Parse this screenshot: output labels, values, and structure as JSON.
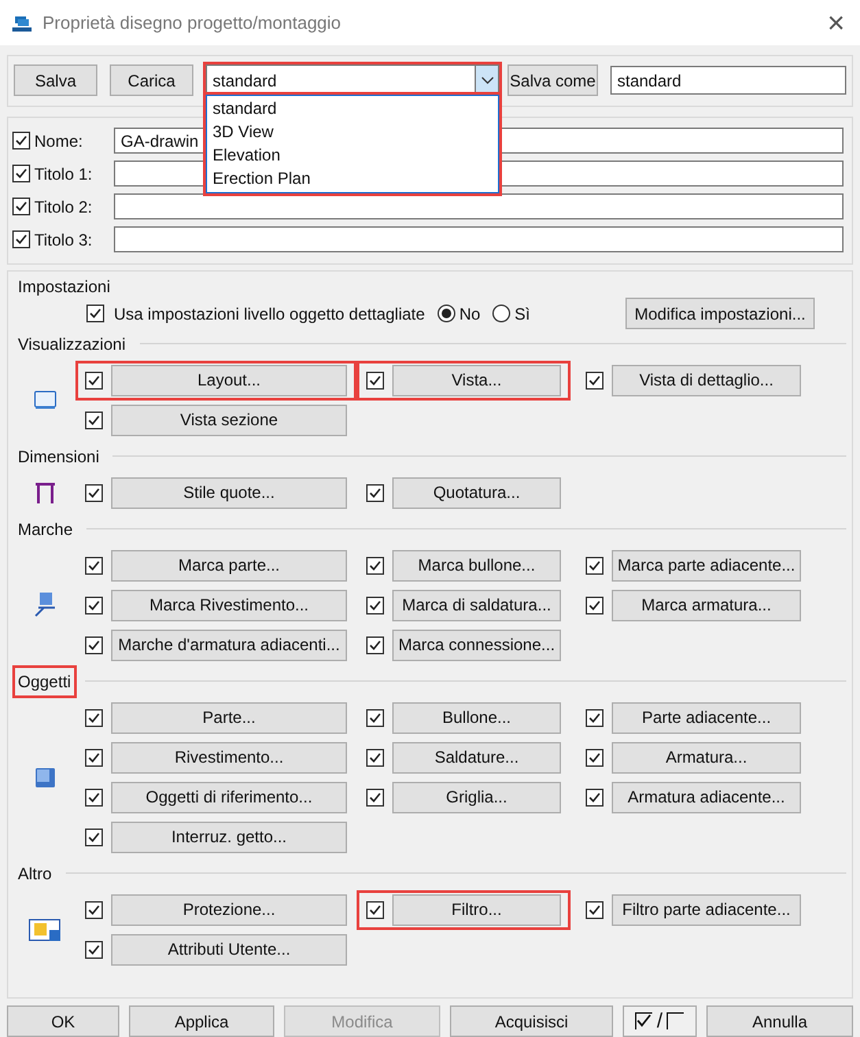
{
  "window": {
    "title": "Proprietà disegno progetto/montaggio",
    "close": "×"
  },
  "toolbar": {
    "buttons": [
      "Salva",
      "Carica"
    ],
    "preset_combo": {
      "value": "standard",
      "expanded": true,
      "highlighted": true,
      "options": [
        "standard",
        "3D View",
        "Elevation",
        "Erection Plan"
      ]
    },
    "save_as_button": "Salva come",
    "save_as_field": "standard"
  },
  "titles": [
    {
      "label": "Nome:",
      "checked": true,
      "value": "GA-drawin"
    },
    {
      "label": "Titolo 1:",
      "checked": true
    },
    {
      "label": "Titolo 2:",
      "checked": true
    },
    {
      "label": "Titolo 3:",
      "checked": true
    }
  ],
  "settings": {
    "label": "Impostazioni",
    "detailed": {
      "label": "Usa impostazioni livello oggetto dettagliate",
      "checked": true
    },
    "radios": [
      {
        "label": "No",
        "selected": true
      },
      {
        "label": "Sì",
        "selected": false
      }
    ],
    "button": "Modifica impostazioni..."
  },
  "sections": [
    {
      "label": "Visualizzazioni",
      "kind": "view",
      "highlighted": false,
      "rows": [
        [
          {
            "label": "Layout...",
            "checked": true,
            "highlighted": true
          },
          {
            "label": "Vista...",
            "checked": true,
            "highlighted": true
          },
          {
            "label": "Vista di dettaglio...",
            "checked": true,
            "highlighted": false
          }
        ],
        [
          {
            "label": "Vista sezione",
            "checked": true,
            "highlighted": false
          }
        ]
      ]
    },
    {
      "label": "Dimensioni",
      "kind": "dimension",
      "highlighted": false,
      "rows": [
        [
          {
            "label": "Stile quote...",
            "checked": true,
            "highlighted": false
          },
          {
            "label": "Quotatura...",
            "checked": true,
            "highlighted": false
          }
        ]
      ]
    },
    {
      "label": "Marche",
      "kind": "mark",
      "highlighted": false,
      "rows": [
        [
          {
            "label": "Marca parte...",
            "checked": true,
            "highlighted": false
          },
          {
            "label": "Marca bullone...",
            "checked": true,
            "highlighted": false
          },
          {
            "label": "Marca parte adiacente...",
            "checked": true,
            "highlighted": false
          }
        ],
        [
          {
            "label": "Marca Rivestimento...",
            "checked": true,
            "highlighted": false
          },
          {
            "label": "Marca di saldatura...",
            "checked": true,
            "highlighted": false
          },
          {
            "label": "Marca armatura...",
            "checked": true,
            "highlighted": false
          }
        ],
        [
          {
            "label": "Marche d'armatura adiacenti...",
            "checked": true,
            "highlighted": false
          },
          {
            "label": "Marca connessione...",
            "checked": true,
            "highlighted": false
          }
        ]
      ]
    },
    {
      "label": "Oggetti",
      "kind": "object",
      "highlighted": true,
      "rows": [
        [
          {
            "label": "Parte...",
            "checked": true,
            "highlighted": false
          },
          {
            "label": "Bullone...",
            "checked": true,
            "highlighted": false
          },
          {
            "label": "Parte adiacente...",
            "checked": true,
            "highlighted": false
          }
        ],
        [
          {
            "label": "Rivestimento...",
            "checked": true,
            "highlighted": false
          },
          {
            "label": "Saldature...",
            "checked": true,
            "highlighted": false
          },
          {
            "label": "Armatura...",
            "checked": true,
            "highlighted": false
          }
        ],
        [
          {
            "label": "Oggetti di riferimento...",
            "checked": true,
            "highlighted": false
          },
          {
            "label": "Griglia...",
            "checked": true,
            "highlighted": false
          },
          {
            "label": "Armatura adiacente...",
            "checked": true,
            "highlighted": false
          }
        ],
        [
          {
            "label": "Interruz. getto...",
            "checked": true,
            "highlighted": false
          }
        ]
      ]
    },
    {
      "label": "Altro",
      "kind": "other",
      "highlighted": false,
      "rows": [
        [
          {
            "label": "Protezione...",
            "checked": true,
            "highlighted": false
          },
          {
            "label": "Filtro...",
            "checked": true,
            "highlighted": true
          },
          {
            "label": "Filtro parte adiacente...",
            "checked": true,
            "highlighted": false
          }
        ],
        [
          {
            "label": "Attributi Utente...",
            "checked": true,
            "highlighted": false
          }
        ]
      ]
    }
  ],
  "footer": {
    "buttons": [
      {
        "label": "OK",
        "disabled": false
      },
      {
        "label": "Applica",
        "disabled": false
      },
      {
        "label": "Modifica",
        "disabled": true
      },
      {
        "label": "Acquisisci",
        "disabled": false
      }
    ],
    "toggle_separator": "/",
    "cancel": "Annulla"
  }
}
